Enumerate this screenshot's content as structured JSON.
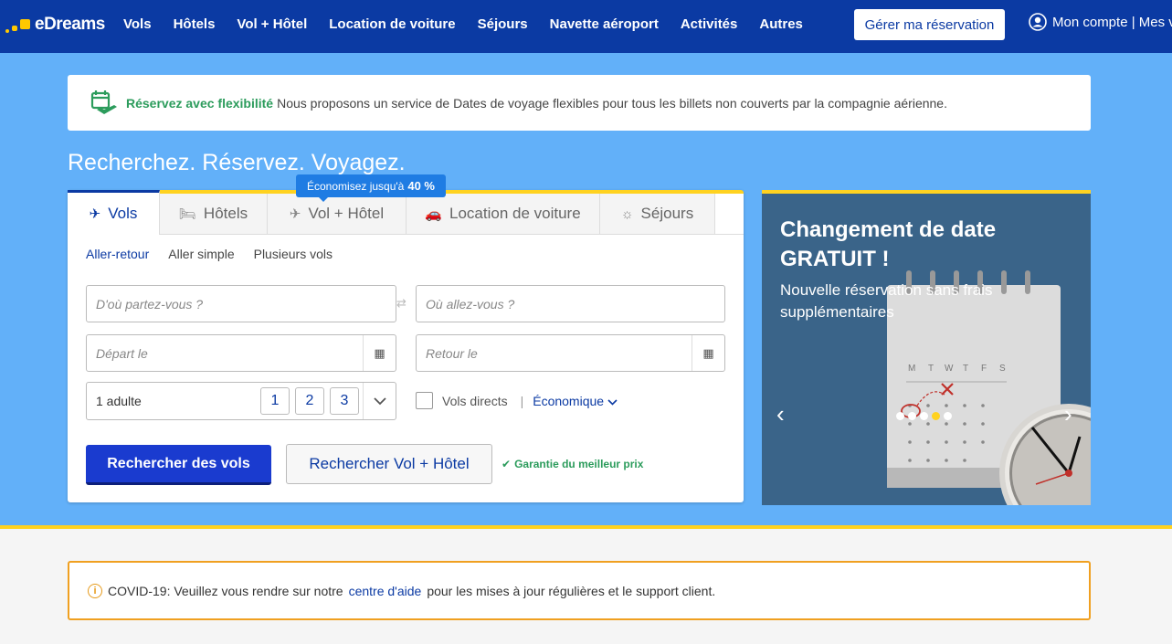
{
  "nav": {
    "logo_text": "eDreams",
    "items": [
      "Vols",
      "Hôtels",
      "Vol + Hôtel",
      "Location de voiture",
      "Séjours",
      "Navette aéroport",
      "Activités",
      "Autres"
    ],
    "manage_booking": "Gérer ma réservation",
    "account": "Mon compte | Mes v"
  },
  "banner": {
    "strong": "Réservez avec flexibilité",
    "text": "Nous proposons un service de Dates de voyage flexibles pour tous les billets non couverts par la compagnie aérienne."
  },
  "hero": {
    "title": "Recherchez. Réservez. Voyagez."
  },
  "search": {
    "badge_text": "Économisez jusqu'à",
    "badge_value": "40 %",
    "tabs": [
      {
        "label": "Vols",
        "icon": "plane-icon"
      },
      {
        "label": "Hôtels",
        "icon": "bed-icon"
      },
      {
        "label": "Vol + Hôtel",
        "icon": "plane-bed-icon"
      },
      {
        "label": "Location de voiture",
        "icon": "car-icon"
      },
      {
        "label": "Séjours",
        "icon": "sun-icon"
      }
    ],
    "trip_types": [
      "Aller-retour",
      "Aller simple",
      "Plusieurs vols"
    ],
    "from_placeholder": "D'où partez-vous ?",
    "to_placeholder": "Où allez-vous ?",
    "depart_placeholder": "Départ le",
    "return_placeholder": "Retour le",
    "passengers": "1 adulte",
    "pax_options": [
      "1",
      "2",
      "3"
    ],
    "direct_label": "Vols directs",
    "cabin": "Économique",
    "search_flights": "Rechercher des vols",
    "search_flight_hotel": "Rechercher Vol + Hôtel",
    "guarantee": "Garantie du meilleur prix"
  },
  "promo": {
    "title": "Changement de date GRATUIT !",
    "subtitle": "Nouvelle réservation sans frais supplémentaires",
    "calendar_days": [
      "M",
      "T",
      "W",
      "T",
      "F",
      "S"
    ],
    "dots": 5,
    "active_dot": 4
  },
  "covid": {
    "prefix": "COVID-19: Veuillez vous rendre sur notre",
    "link": "centre d'aide",
    "suffix": "pour les mises à jour régulières et le support client."
  }
}
